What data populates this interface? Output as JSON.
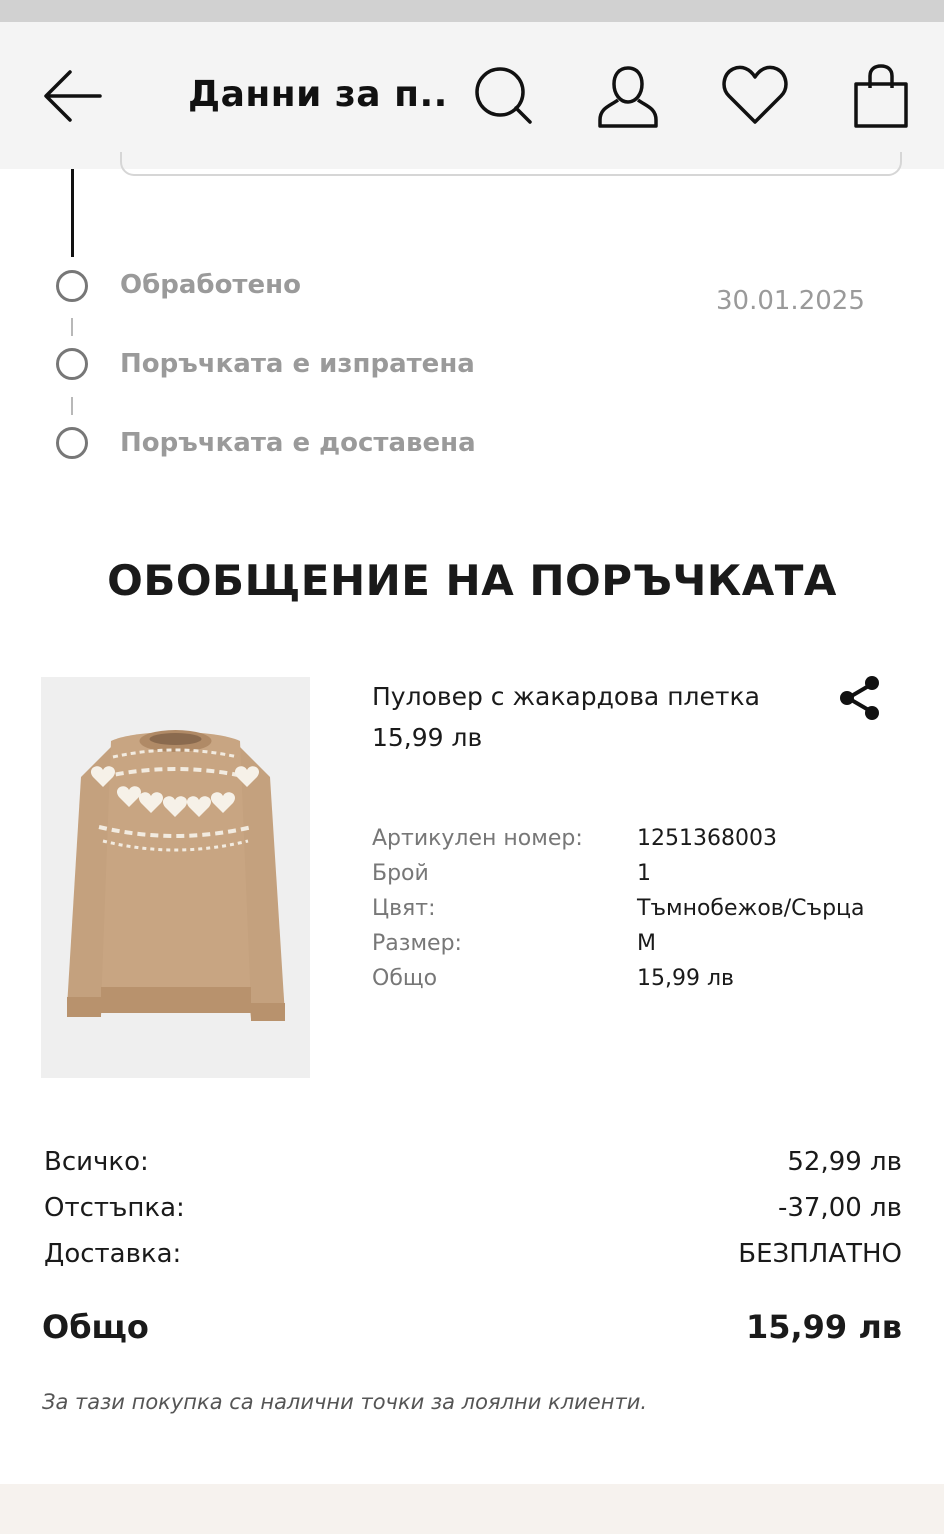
{
  "header": {
    "title": "Данни за п...",
    "icons": [
      "back-arrow-icon",
      "search-icon",
      "user-icon",
      "heart-icon",
      "shopping-bag-icon"
    ]
  },
  "timeline": {
    "steps": [
      {
        "label": "Обработено",
        "date": "30.01.2025"
      },
      {
        "label": "Поръчката е изпратена"
      },
      {
        "label": "Поръчката е доставена"
      }
    ]
  },
  "summary": {
    "title": "ОБОБЩЕНИЕ НА ПОРЪЧКАТА"
  },
  "product": {
    "name": "Пуловер с жакардова плетка",
    "price": "15,99 лв",
    "details": [
      {
        "key": "Артикулен номер:",
        "value": "1251368003"
      },
      {
        "key": "Брой",
        "value": "1"
      },
      {
        "key": "Цвят:",
        "value": "Тъмнобежов/Сърца"
      },
      {
        "key": "Размер:",
        "value": "M"
      },
      {
        "key": "Общо",
        "value": "15,99 лв"
      }
    ]
  },
  "totals": {
    "rows": [
      {
        "key": "Всичко:",
        "value": "52,99 лв"
      },
      {
        "key": "Отстъпка:",
        "value": "-37,00 лв"
      },
      {
        "key": "Доставка:",
        "value": "БЕЗПЛАТНО"
      }
    ],
    "grand_key": "Общо",
    "grand_value": "15,99 лв"
  },
  "loyalty_note": "За тази покупка са налични точки за лоялни клиенти.",
  "colors": {
    "header_bg": "#f4f4f4",
    "text": "#1a1a1a",
    "muted": "#9a9a9a",
    "sweater": "#c4a17e"
  }
}
